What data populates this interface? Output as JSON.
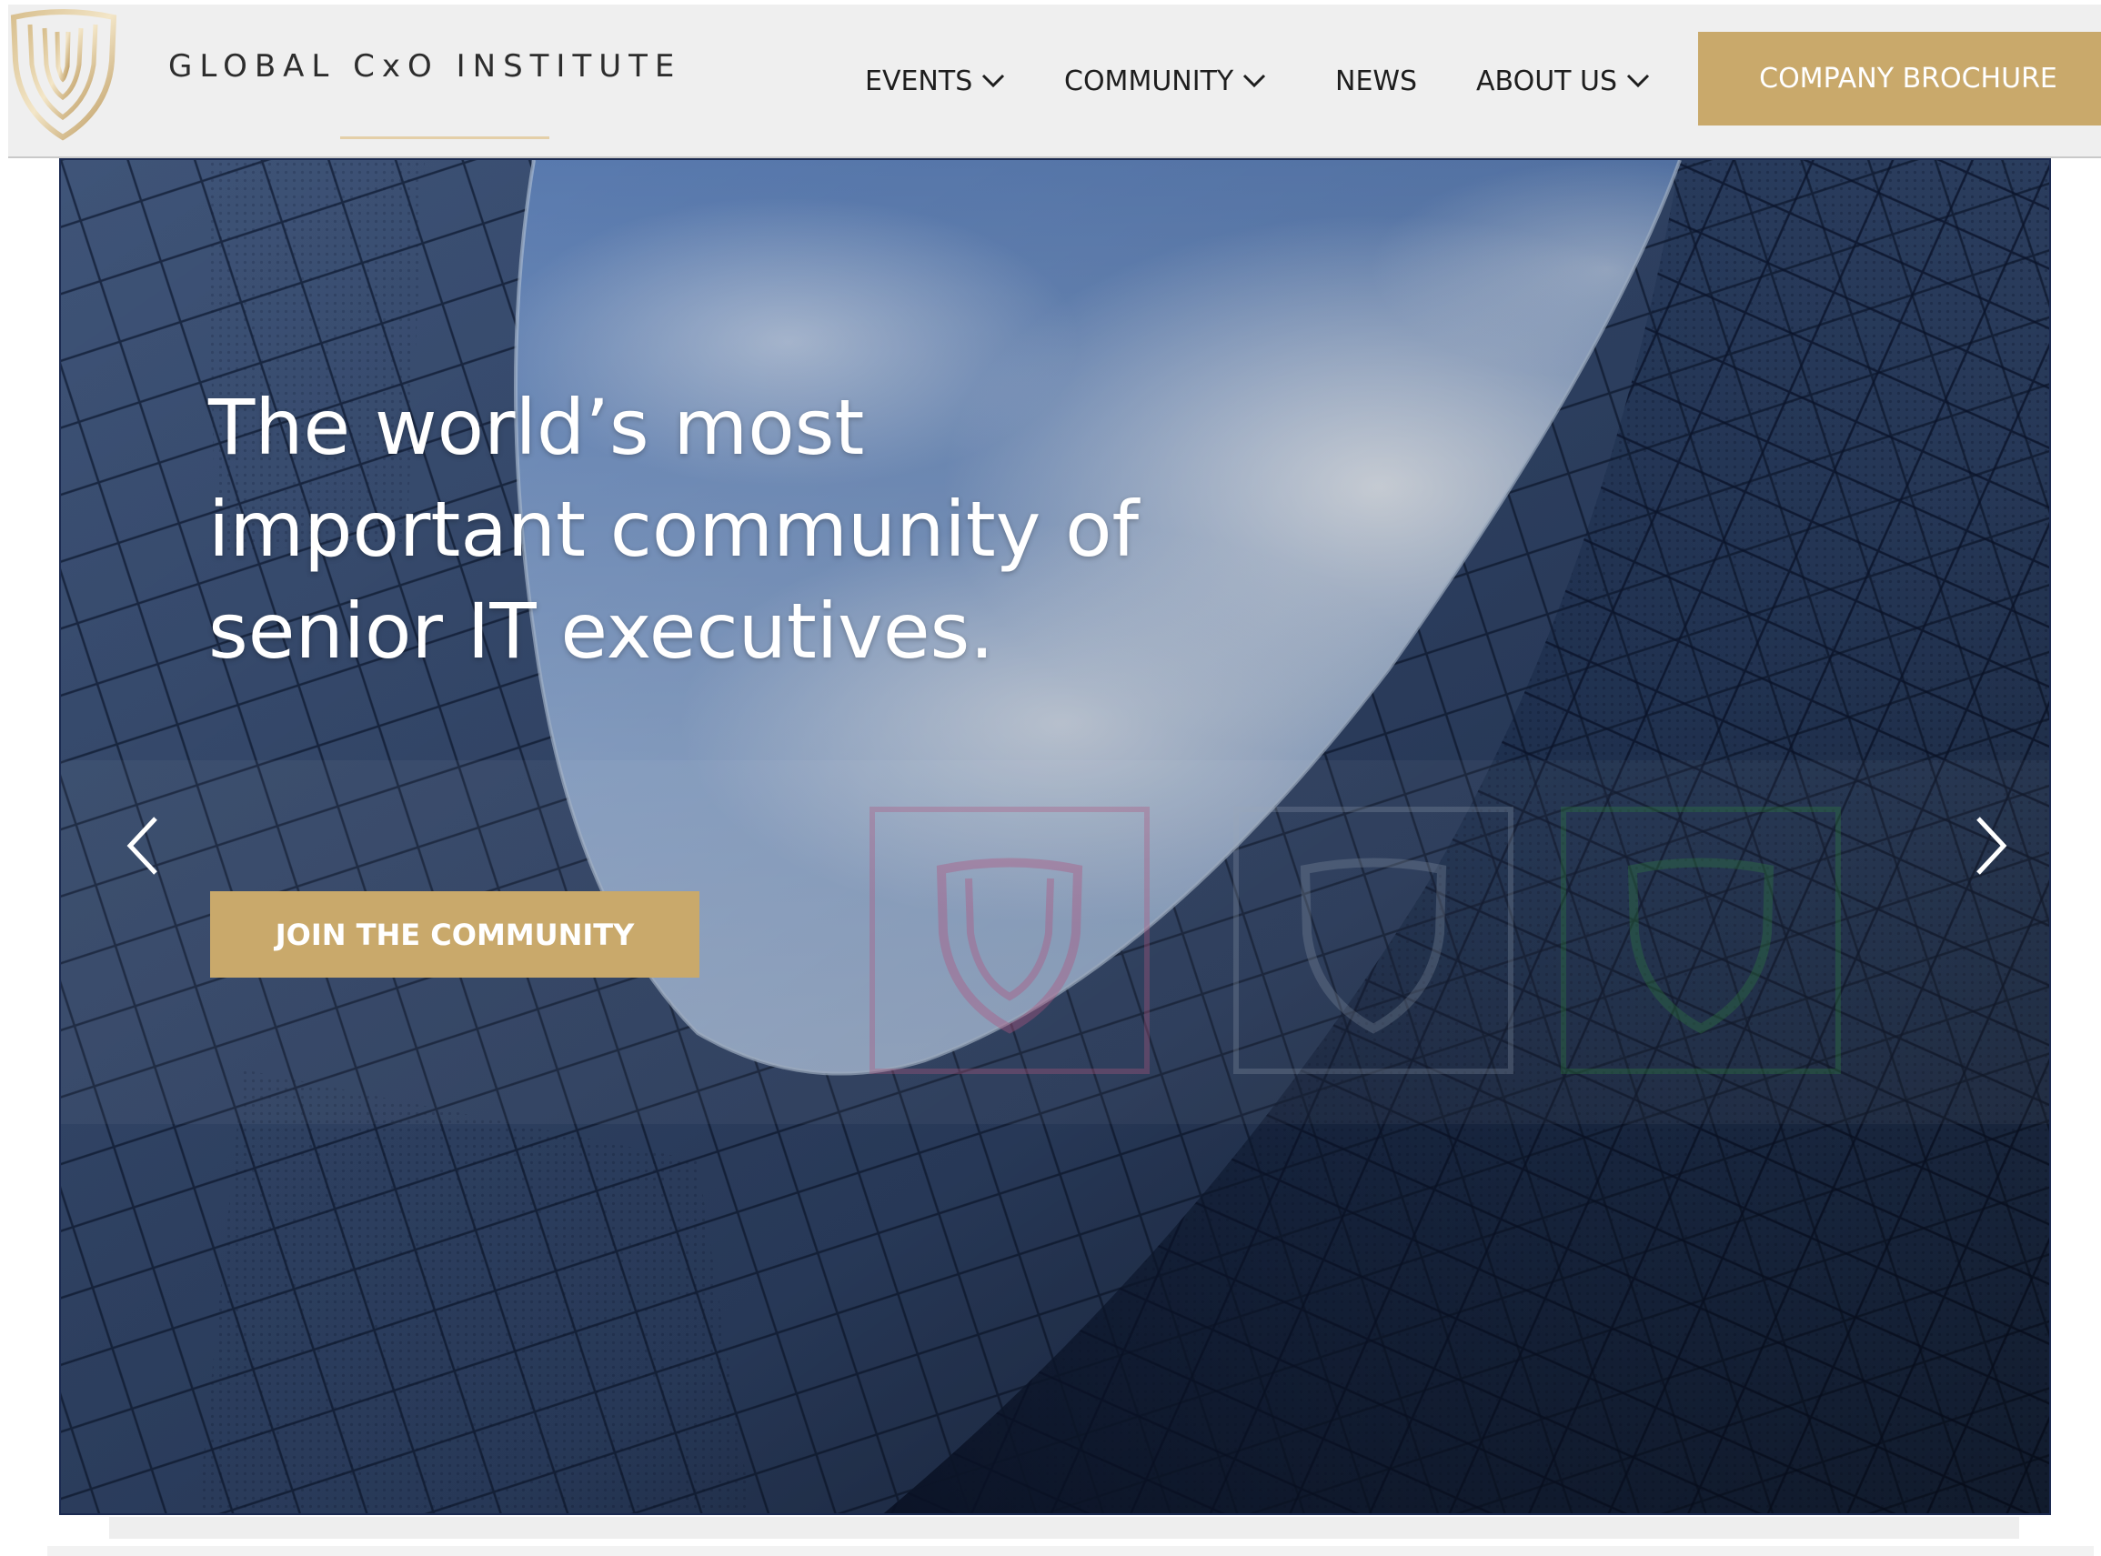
{
  "header": {
    "brand_name": "GLOBAL CxO INSTITUTE",
    "logo_icon": "shield-logo-icon",
    "nav": [
      {
        "label": "EVENTS",
        "has_dropdown": true
      },
      {
        "label": "COMMUNITY",
        "has_dropdown": true
      },
      {
        "label": "NEWS",
        "has_dropdown": false
      },
      {
        "label": "ABOUT US",
        "has_dropdown": true
      }
    ],
    "cta_label": "COMPANY BROCHURE"
  },
  "hero": {
    "headline_lines": [
      "The world’s most",
      "important community of",
      "senior IT executives."
    ],
    "cta_label": "JOIN THE COMMUNITY",
    "prev_icon": "chevron-left-icon",
    "next_icon": "chevron-right-icon"
  },
  "colors": {
    "gold": "#c9a96b",
    "header_bg": "#efefef",
    "nav_text": "#1e1e1e",
    "hero_text": "#ffffff"
  }
}
